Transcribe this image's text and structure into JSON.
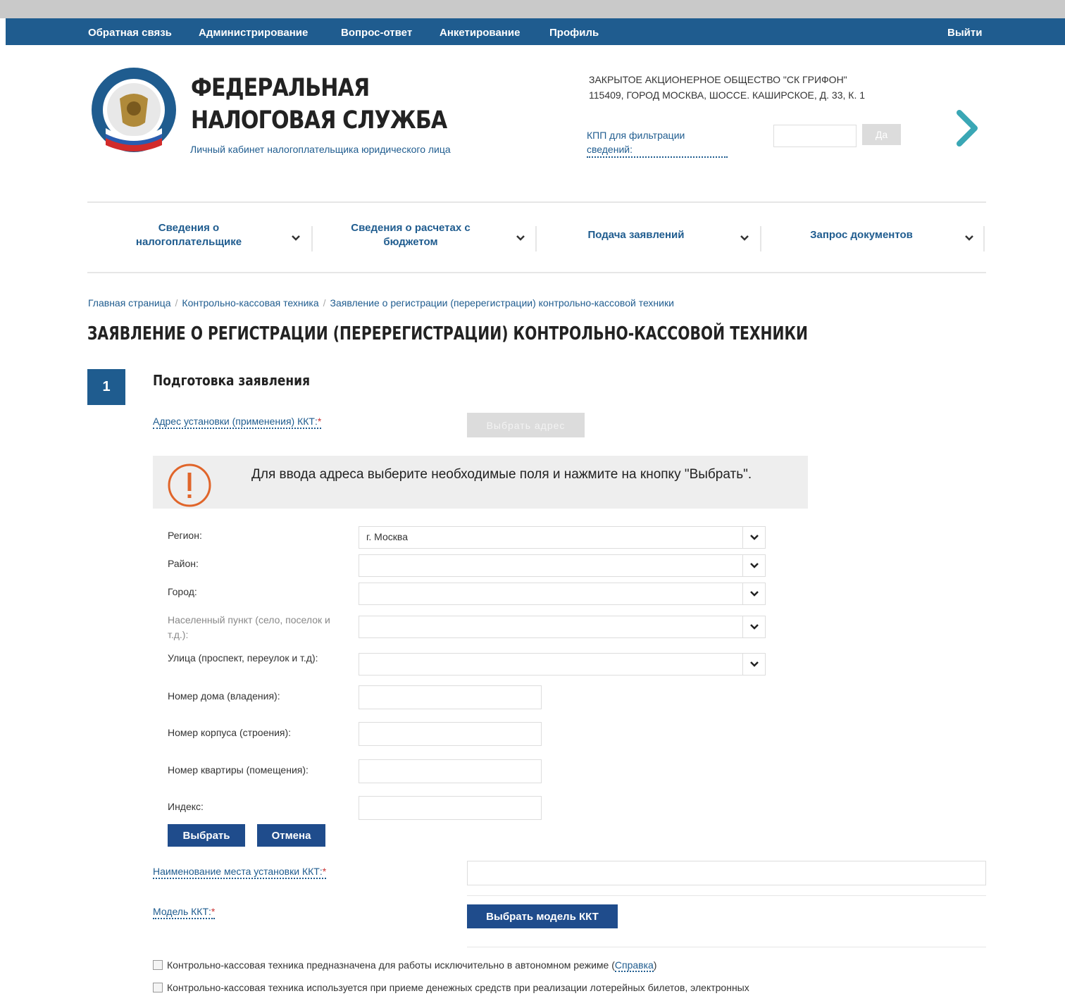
{
  "topnav": {
    "items": [
      "Обратная связь",
      "Администрирование",
      "Вопрос-ответ",
      "Анкетирование",
      "Профиль"
    ],
    "logout": "Выйти"
  },
  "header": {
    "brand_line1": "ФЕДЕРАЛЬНАЯ",
    "brand_line2": "НАЛОГОВАЯ СЛУЖБА",
    "brand_sub": "Личный кабинет налогоплательщика юридического лица",
    "org_name": "ЗАКРЫТОЕ АКЦИОНЕРНОЕ ОБЩЕСТВО \"СК ГРИФОН\"",
    "org_address": "115409, ГОРОД МОСКВА, ШОССЕ. КАШИРСКОЕ, д. 33, к. 1",
    "kpp_label": "КПП для фильтрации сведений:",
    "kpp_value": "",
    "kpp_button": "Да"
  },
  "mainmenu": [
    {
      "label": "Сведения о налогоплательщике"
    },
    {
      "label": "Сведения о расчетах с бюджетом"
    },
    {
      "label": "Подача заявлений"
    },
    {
      "label": "Запрос документов"
    }
  ],
  "breadcrumb": [
    "Главная страница",
    "Контрольно-кассовая техника",
    "Заявление о регистрации (перерегистрации) контрольно-кассовой техники"
  ],
  "page_title": "ЗАЯВЛЕНИЕ О РЕГИСТРАЦИИ (ПЕРЕРЕГИСТРАЦИИ) КОНТРОЛЬНО-КАССОВОЙ ТЕХНИКИ",
  "step": {
    "number": "1",
    "title": "Подготовка заявления"
  },
  "form": {
    "address_label": "Адрес установки (применения) ККТ:",
    "required_mark": "*",
    "select_address_button": "Выбрать адрес",
    "notice": "Для ввода адреса выберите необходимые поля и нажмите на кнопку \"Выбрать\".",
    "fields": {
      "region": {
        "label": "Регион:",
        "value": "г. Москва"
      },
      "district": {
        "label": "Район:",
        "value": ""
      },
      "city": {
        "label": "Город:",
        "value": ""
      },
      "settlement": {
        "label": "Населенный пункт (село, поселок и т.д.):",
        "value": ""
      },
      "street": {
        "label": "Улица (проспект, переулок и т.д):",
        "value": ""
      },
      "house": {
        "label": "Номер дома (владения):",
        "value": ""
      },
      "building": {
        "label": "Номер корпуса (строения):",
        "value": ""
      },
      "apartment": {
        "label": "Номер квартиры (помещения):",
        "value": ""
      },
      "index": {
        "label": "Индекс:",
        "value": ""
      }
    },
    "choose_button": "Выбрать",
    "cancel_button": "Отмена",
    "place_name_label": "Наименование места установки ККТ:",
    "place_name_value": "",
    "model_label": "Модель ККТ:",
    "choose_model_button": "Выбрать модель ККТ",
    "checkbox1": "Контрольно-кассовая техника предназначена для работы исключительно в автономном режиме (",
    "help_link": "Справка",
    "checkbox1_end": ")",
    "checkbox2": "Контрольно-кассовая техника используется при приеме денежных средств при реализации лотерейных билетов, электронных"
  },
  "colors": {
    "topbar": "#1f5c8f",
    "link": "#1f5c8f",
    "primary_button": "#1f4c8c",
    "step_badge": "#1f5c8f",
    "notice_icon": "#e0652a",
    "next_arrow": "#3aa7b5"
  }
}
